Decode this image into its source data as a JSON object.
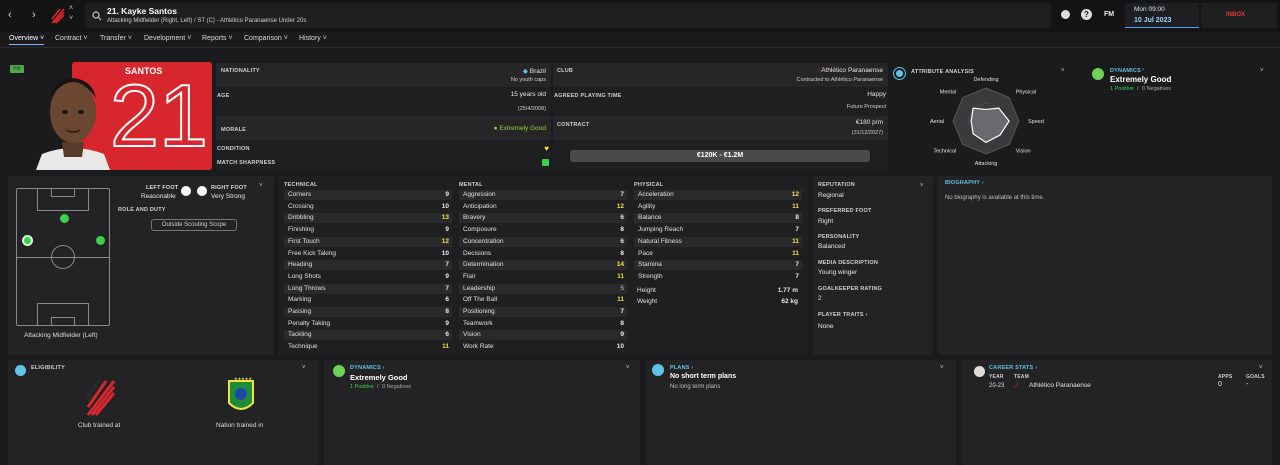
{
  "header": {
    "player_title": "21. Kayke Santos",
    "subtitle": "Attacking Midfielder (Right, Left) / ST (C) - Athlético Paranaense Under 20s",
    "fm_label": "FM",
    "day_time": "Mon 09:00",
    "date": "10 Jul 2023",
    "inbox": "INBOX"
  },
  "nav": {
    "tabs": [
      "Overview",
      "Contract",
      "Transfer",
      "Development",
      "Reports",
      "Comparison",
      "History"
    ]
  },
  "profile": {
    "badge": "Yth",
    "name_on_shirt": "SANTOS",
    "number": "21",
    "nationality_label": "NATIONALITY",
    "nationality": "Brazil",
    "youth_caps": "No youth caps",
    "club_label": "CLUB",
    "club": "Athlético Paranaense",
    "club_contract": "Contracted to Athlético Paranaense",
    "age_label": "AGE",
    "age": "15 years old",
    "dob": "(25/4/2008)",
    "agreed_label": "AGREED PLAYING TIME",
    "agreed": "Happy",
    "agreed_sub": "Future Prospect",
    "morale_label": "MORALE",
    "morale": "Extremely Good",
    "contract_label": "CONTRACT",
    "wage": "€180 p/m",
    "expiry": "(31/12/2027)",
    "condition_label": "CONDITION",
    "sharpness_label": "MATCH SHARPNESS",
    "value_range": "€120K - €1.2M"
  },
  "attr_analysis": {
    "title": "ATTRIBUTE ANALYSIS",
    "labels": [
      "Defending",
      "Physical",
      "Speed",
      "Vision",
      "Attacking",
      "Technical",
      "Aerial",
      "Mental"
    ],
    "values": [
      0.35,
      0.55,
      0.7,
      0.6,
      0.65,
      0.55,
      0.45,
      0.55
    ]
  },
  "dynamics": {
    "title": "DYNAMICS",
    "value": "Extremely Good",
    "positive": "1 Positive",
    "negatives": "0 Negatives"
  },
  "position": {
    "left_foot_label": "LEFT FOOT",
    "left_foot": "Reasonable",
    "right_foot_label": "RIGHT FOOT",
    "right_foot": "Very Strong",
    "role_label": "ROLE AND DUTY",
    "scouting_btn": "Outside Scouting Scope",
    "position_name": "Attacking Midfielder (Left)"
  },
  "attributes": {
    "technical_title": "TECHNICAL",
    "technical": [
      [
        "Corners",
        9
      ],
      [
        "Crossing",
        10
      ],
      [
        "Dribbling",
        13
      ],
      [
        "Finishing",
        9
      ],
      [
        "First Touch",
        12
      ],
      [
        "Free Kick Taking",
        10
      ],
      [
        "Heading",
        7
      ],
      [
        "Long Shots",
        9
      ],
      [
        "Long Throws",
        7
      ],
      [
        "Marking",
        6
      ],
      [
        "Passing",
        8
      ],
      [
        "Penalty Taking",
        9
      ],
      [
        "Tackling",
        6
      ],
      [
        "Technique",
        11
      ]
    ],
    "mental_title": "MENTAL",
    "mental": [
      [
        "Aggression",
        7
      ],
      [
        "Anticipation",
        12
      ],
      [
        "Bravery",
        6
      ],
      [
        "Composure",
        8
      ],
      [
        "Concentration",
        6
      ],
      [
        "Decisions",
        8
      ],
      [
        "Determination",
        14
      ],
      [
        "Flair",
        11
      ],
      [
        "Leadership",
        5
      ],
      [
        "Off The Ball",
        11
      ],
      [
        "Positioning",
        7
      ],
      [
        "Teamwork",
        8
      ],
      [
        "Vision",
        9
      ],
      [
        "Work Rate",
        10
      ]
    ],
    "physical_title": "PHYSICAL",
    "physical": [
      [
        "Acceleration",
        12
      ],
      [
        "Agility",
        11
      ],
      [
        "Balance",
        8
      ],
      [
        "Jumping Reach",
        7
      ],
      [
        "Natural Fitness",
        11
      ],
      [
        "Pace",
        11
      ],
      [
        "Stamina",
        7
      ],
      [
        "Strength",
        7
      ]
    ],
    "height_label": "Height",
    "height": "1.77 m",
    "weight_label": "Weight",
    "weight": "62 kg"
  },
  "info": {
    "reputation_label": "REPUTATION",
    "reputation": "Regional",
    "foot_label": "PREFERRED FOOT",
    "foot": "Right",
    "personality_label": "PERSONALITY",
    "personality": "Balanced",
    "media_label": "MEDIA DESCRIPTION",
    "media": "Young winger",
    "gk_label": "GOALKEEPER RATING",
    "gk": "2",
    "traits_label": "PLAYER TRAITS",
    "traits": "None"
  },
  "biography": {
    "title": "BIOGRAPHY",
    "text": "No biography is available at this time."
  },
  "eligibility": {
    "title": "ELIGIBILITY",
    "club_trained": "Club trained at",
    "nation_trained": "Nation trained in"
  },
  "plans": {
    "title": "PLANS",
    "short": "No short term plans",
    "long": "No long term plans"
  },
  "career": {
    "title": "CAREER STATS",
    "year_h": "YEAR",
    "team_h": "TEAM",
    "apps_h": "APPS",
    "goals_h": "GOALS",
    "year": "20-23",
    "team": "Athlético Paranaense",
    "apps": "0",
    "goals": "-"
  },
  "colors": {
    "accent": "#f3e341",
    "positive": "#3fcf4e",
    "link": "#5fc4e6",
    "club_red": "#d8262e"
  }
}
